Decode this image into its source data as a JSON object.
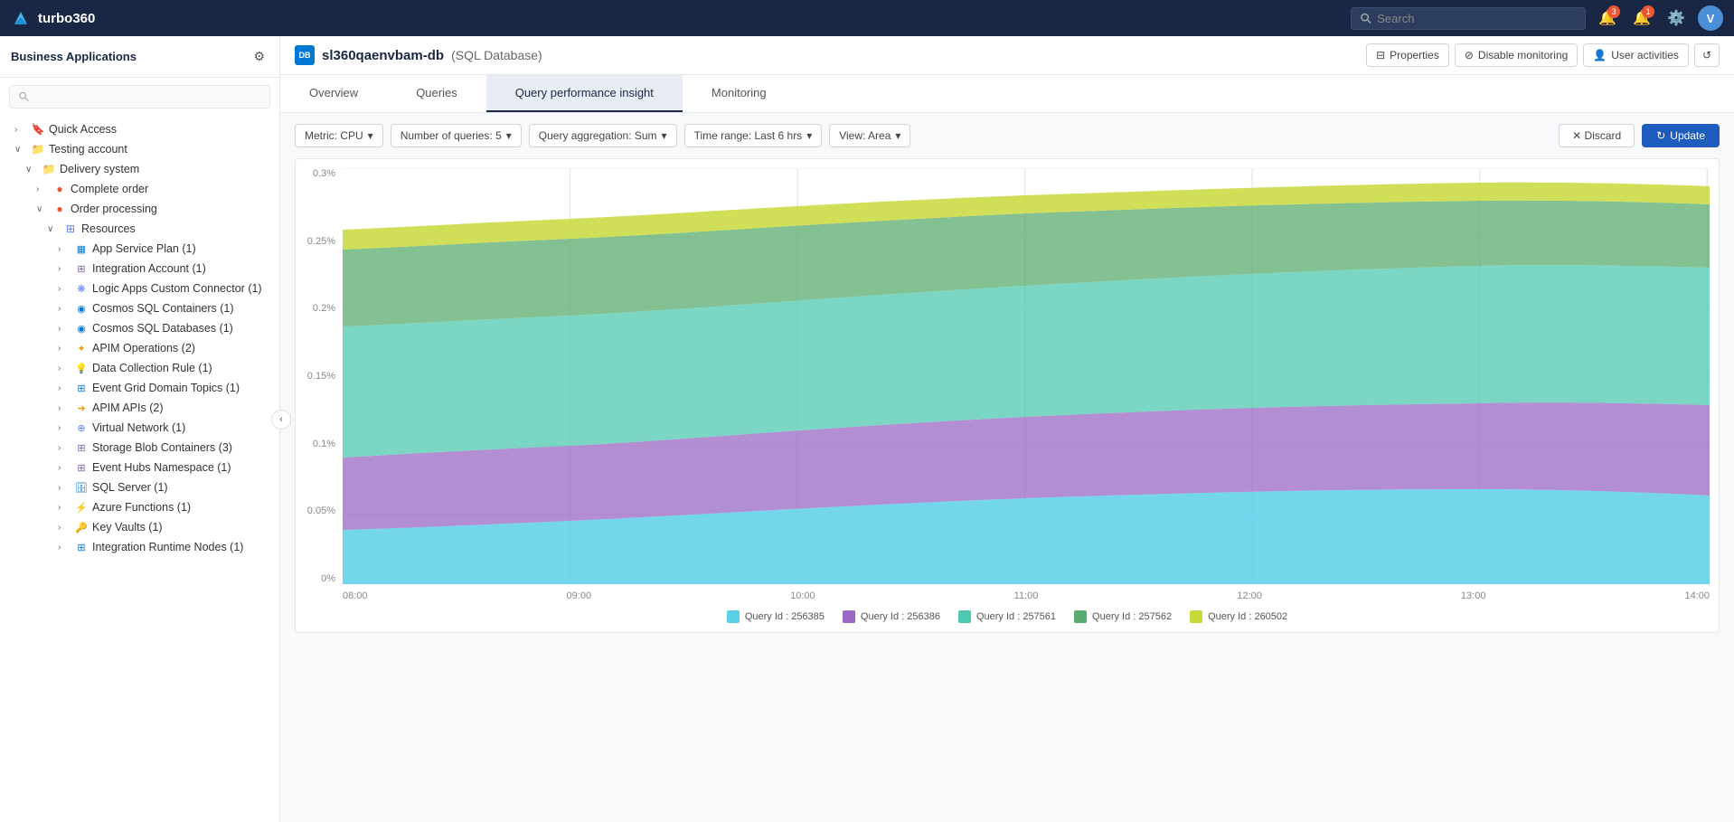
{
  "app": {
    "name": "turbo360"
  },
  "topnav": {
    "search_placeholder": "Search",
    "notification_count": "3",
    "alert_count": "1",
    "avatar_label": "V"
  },
  "sidebar": {
    "title": "Business Applications",
    "search_placeholder": "",
    "tree": [
      {
        "id": "quick-access",
        "label": "Quick Access",
        "indent": 1,
        "chevron": "›",
        "icon": "bookmark",
        "type": "section"
      },
      {
        "id": "testing-account",
        "label": "Testing account",
        "indent": 1,
        "chevron": "∨",
        "icon": "folder",
        "type": "account"
      },
      {
        "id": "delivery-system",
        "label": "Delivery system",
        "indent": 2,
        "chevron": "∨",
        "icon": "folder",
        "type": "folder"
      },
      {
        "id": "complete-order",
        "label": "Complete order",
        "indent": 3,
        "chevron": "›",
        "icon": "dot-red",
        "type": "app"
      },
      {
        "id": "order-processing",
        "label": "Order processing",
        "indent": 3,
        "chevron": "∨",
        "icon": "dot-red",
        "type": "app"
      },
      {
        "id": "resources",
        "label": "Resources",
        "indent": 4,
        "chevron": "∨",
        "icon": "grid",
        "type": "resources"
      },
      {
        "id": "app-service-plan",
        "label": "App Service Plan (1)",
        "indent": 5,
        "chevron": "›",
        "icon": "app-service",
        "type": "resource"
      },
      {
        "id": "integration-account",
        "label": "Integration Account (1)",
        "indent": 5,
        "chevron": "›",
        "icon": "integration",
        "type": "resource"
      },
      {
        "id": "logic-apps-custom",
        "label": "Logic Apps Custom Connector (1)",
        "indent": 5,
        "chevron": "›",
        "icon": "logic-apps",
        "type": "resource"
      },
      {
        "id": "cosmos-sql-containers",
        "label": "Cosmos SQL Containers (1)",
        "indent": 5,
        "chevron": "›",
        "icon": "cosmos",
        "type": "resource"
      },
      {
        "id": "cosmos-sql-databases",
        "label": "Cosmos SQL Databases (1)",
        "indent": 5,
        "chevron": "›",
        "icon": "cosmos",
        "type": "resource"
      },
      {
        "id": "apim-operations",
        "label": "APIM Operations (2)",
        "indent": 5,
        "chevron": "›",
        "icon": "apim",
        "type": "resource"
      },
      {
        "id": "data-collection-rule",
        "label": "Data Collection Rule (1)",
        "indent": 5,
        "chevron": "›",
        "icon": "data-rule",
        "type": "resource"
      },
      {
        "id": "event-grid-domain",
        "label": "Event Grid Domain Topics (1)",
        "indent": 5,
        "chevron": "›",
        "icon": "event-grid",
        "type": "resource"
      },
      {
        "id": "apim-apis",
        "label": "APIM APIs (2)",
        "indent": 5,
        "chevron": "›",
        "icon": "apim",
        "type": "resource"
      },
      {
        "id": "virtual-network",
        "label": "Virtual Network (1)",
        "indent": 5,
        "chevron": "›",
        "icon": "vnet",
        "type": "resource"
      },
      {
        "id": "storage-blob",
        "label": "Storage Blob Containers (3)",
        "indent": 5,
        "chevron": "›",
        "icon": "storage",
        "type": "resource"
      },
      {
        "id": "event-hubs",
        "label": "Event Hubs Namespace (1)",
        "indent": 5,
        "chevron": "›",
        "icon": "event-hubs",
        "type": "resource"
      },
      {
        "id": "sql-server",
        "label": "SQL Server (1)",
        "indent": 5,
        "chevron": "›",
        "icon": "sql",
        "type": "resource"
      },
      {
        "id": "azure-functions",
        "label": "Azure Functions (1)",
        "indent": 5,
        "chevron": "›",
        "icon": "functions",
        "type": "resource"
      },
      {
        "id": "key-vaults",
        "label": "Key Vaults (1)",
        "indent": 5,
        "chevron": "›",
        "icon": "key-vault",
        "type": "resource"
      },
      {
        "id": "integration-runtime",
        "label": "Integration Runtime Nodes (1)",
        "indent": 5,
        "chevron": "›",
        "icon": "integration-rt",
        "type": "resource"
      }
    ],
    "collapse_label": "‹"
  },
  "resource": {
    "icon_label": "DB",
    "name": "sl360qaenvbam-db",
    "type": "(SQL Database)"
  },
  "header_buttons": {
    "properties": "Properties",
    "disable_monitoring": "Disable monitoring",
    "user_activities": "User activities",
    "refresh_icon": "↺"
  },
  "tabs": [
    {
      "id": "overview",
      "label": "Overview",
      "active": false
    },
    {
      "id": "queries",
      "label": "Queries",
      "active": false
    },
    {
      "id": "query-performance",
      "label": "Query performance insight",
      "active": true
    },
    {
      "id": "monitoring",
      "label": "Monitoring",
      "active": false
    }
  ],
  "chart_controls": {
    "metric_label": "Metric: CPU",
    "num_queries_label": "Number of queries: 5",
    "aggregation_label": "Query aggregation: Sum",
    "time_range_label": "Time range: Last 6 hrs",
    "view_label": "View:  Area",
    "discard_label": "✕ Discard",
    "update_label": "Update"
  },
  "chart": {
    "y_labels": [
      "0.3%",
      "0.25%",
      "0.2%",
      "0.15%",
      "0.1%",
      "0.05%",
      "0%"
    ],
    "x_labels": [
      "08:00",
      "09:00",
      "10:00",
      "11:00",
      "12:00",
      "13:00",
      "14:00"
    ],
    "legend": [
      {
        "id": "q1",
        "label": "Query Id : 256385",
        "color": "#5bcfe8"
      },
      {
        "id": "q2",
        "label": "Query Id : 256386",
        "color": "#9b68c4"
      },
      {
        "id": "q3",
        "label": "Query Id : 257561",
        "color": "#4fc8b0"
      },
      {
        "id": "q4",
        "label": "Query Id : 257562",
        "color": "#5aab6e"
      },
      {
        "id": "q5",
        "label": "Query Id : 260502",
        "color": "#c8d93a"
      }
    ]
  }
}
